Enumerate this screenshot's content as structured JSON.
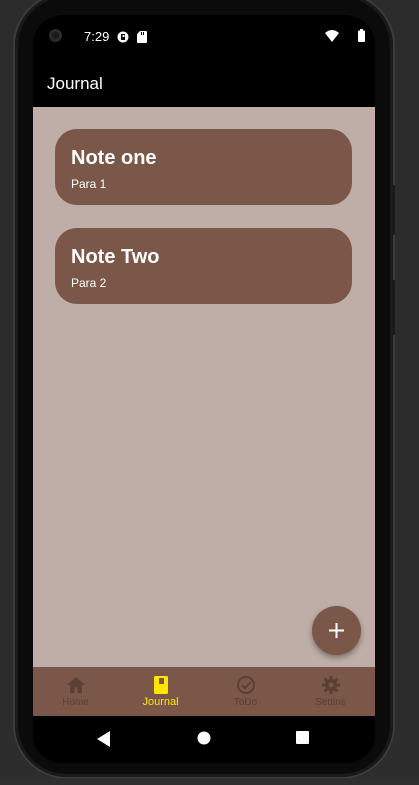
{
  "status_bar": {
    "time": "7:29",
    "icons": [
      "notification-app-icon",
      "sd-card-icon",
      "wifi-icon",
      "battery-icon"
    ]
  },
  "app_bar": {
    "title": "Journal"
  },
  "notes": [
    {
      "title": "Note one",
      "para": "Para 1"
    },
    {
      "title": "Note Two",
      "para": "Para 2"
    }
  ],
  "fab": {
    "icon": "add-icon"
  },
  "bottom_nav": {
    "items": [
      {
        "label": "Home",
        "icon": "home-icon",
        "active": false
      },
      {
        "label": "Journal",
        "icon": "journal-icon",
        "active": true
      },
      {
        "label": "ToDo",
        "icon": "check-circle-icon",
        "active": false
      },
      {
        "label": "Settins",
        "icon": "gear-icon",
        "active": false
      }
    ]
  },
  "colors": {
    "background": "#bfaea8",
    "card": "#7a5748",
    "nav_active": "#ffe600",
    "nav_inactive": "#5a4036"
  }
}
